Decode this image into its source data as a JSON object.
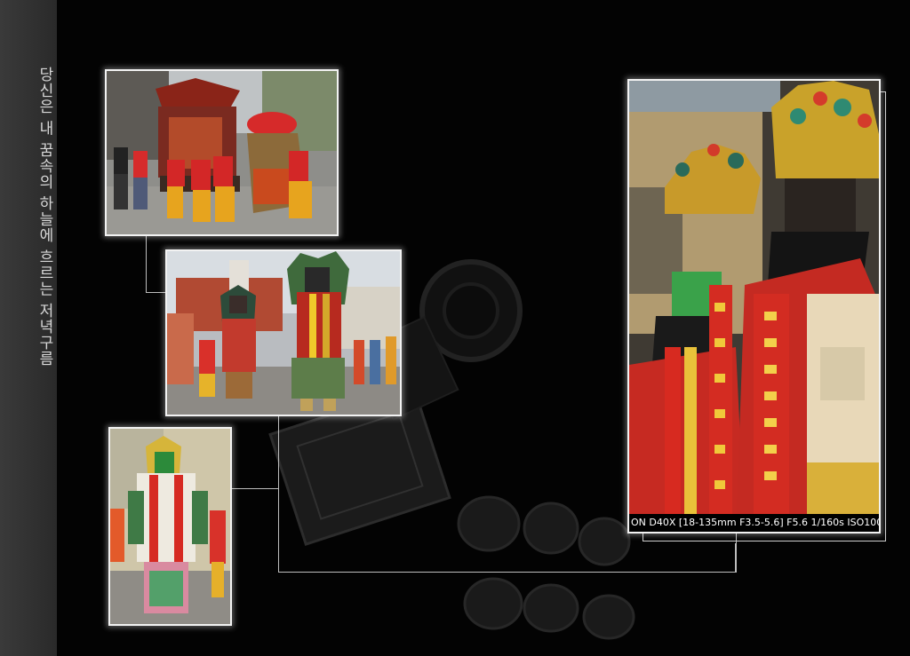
{
  "vertical_title": "당신은 내 꿈속의 하늘에 흐르는 저녁구름",
  "photos": {
    "main": {
      "caption": "ON D40X [18-135mm F3.5-5.6] F5.6 1/160s ISO100"
    }
  }
}
